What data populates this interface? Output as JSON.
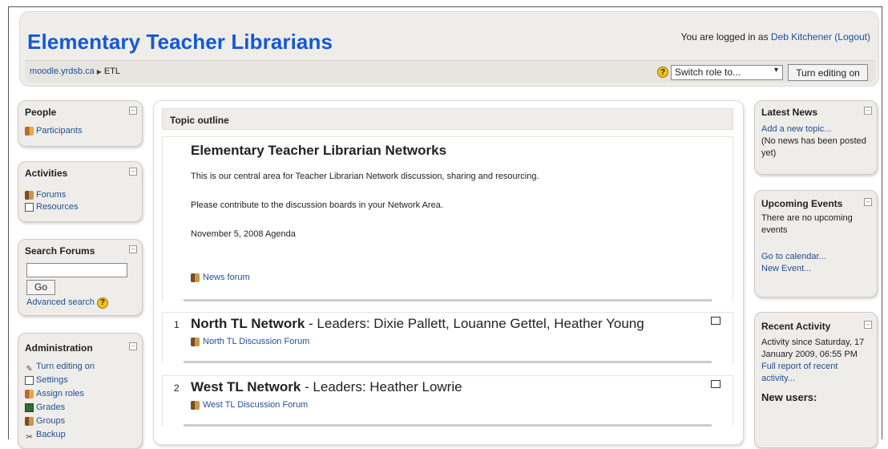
{
  "header": {
    "site_title": "Elementary Teacher Librarians",
    "login_prefix": "You are logged in as ",
    "user_name": "Deb Kitchener",
    "logout_label": "(Logout)",
    "breadcrumb": [
      "moodle.yrdsb.ca",
      "ETL"
    ],
    "breadcrumb_separator": "▶",
    "role_select": {
      "selected": "Switch role to..."
    },
    "edit_button_label": "Turn editing on"
  },
  "left": {
    "people": {
      "title": "People",
      "items": [
        {
          "label": "Participants",
          "icon": "participants-icon"
        }
      ]
    },
    "activities": {
      "title": "Activities",
      "items": [
        {
          "label": "Forums",
          "icon": "forum-icon"
        },
        {
          "label": "Resources",
          "icon": "resource-icon"
        }
      ]
    },
    "search": {
      "title": "Search Forums",
      "input_value": "",
      "go_label": "Go",
      "advanced_label": "Advanced search"
    },
    "admin": {
      "title": "Administration",
      "items": [
        {
          "label": "Turn editing on",
          "icon": "edit-icon"
        },
        {
          "label": "Settings",
          "icon": "settings-icon"
        },
        {
          "label": "Assign roles",
          "icon": "roles-icon"
        },
        {
          "label": "Grades",
          "icon": "grades-icon"
        },
        {
          "label": "Groups",
          "icon": "groups-icon"
        },
        {
          "label": "Backup",
          "icon": "backup-icon"
        }
      ]
    }
  },
  "center": {
    "outline_title": "Topic outline",
    "section0": {
      "heading": "Elementary Teacher Librarian Networks",
      "text1": "This is our central area for Teacher Librarian Network discussion, sharing and resourcing.",
      "text2": "Please contribute to the discussion boards in your Network Area.",
      "agenda_link": "November 5, 2008 Agenda",
      "news_forum": "News forum"
    },
    "weeks": [
      {
        "number": "1",
        "title": "North TL Network",
        "leaders": " - Leaders: Dixie Pallett, Louanne Gettel, Heather Young",
        "forum": "North TL Discussion Forum"
      },
      {
        "number": "2",
        "title": "West TL Network",
        "leaders": " - Leaders: Heather Lowrie",
        "forum": "West TL Discussion Forum"
      }
    ]
  },
  "right": {
    "latest_news": {
      "title": "Latest News",
      "add_link": "Add a new topic...",
      "empty_text": "(No news has been posted yet)"
    },
    "upcoming": {
      "title": "Upcoming Events",
      "empty_text": "There are no upcoming events",
      "calendar_link": "Go to calendar...",
      "new_event_link": "New Event..."
    },
    "recent": {
      "title": "Recent Activity",
      "since_text": "Activity since Saturday, 17 January 2009, 06:55 PM",
      "report_link": "Full report of recent activity...",
      "new_users": "New users:"
    }
  }
}
